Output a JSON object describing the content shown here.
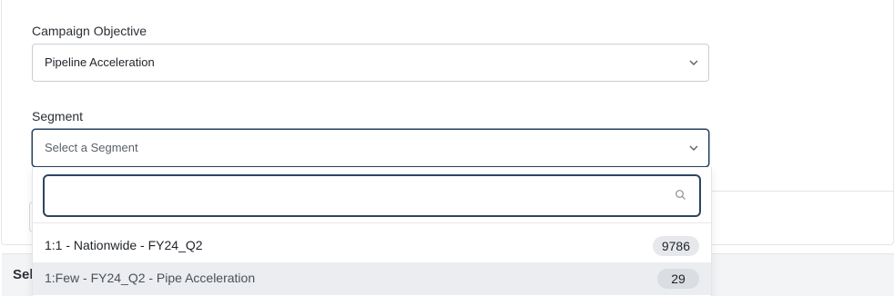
{
  "form": {
    "objective": {
      "label": "Campaign Objective",
      "value": "Pipeline Acceleration"
    },
    "segment": {
      "label": "Segment",
      "placeholder": "Select a Segment"
    }
  },
  "dropdown": {
    "search_value": "",
    "options": [
      {
        "label": "1:1 - Nationwide - FY24_Q2",
        "count": "9786"
      },
      {
        "label": "1:Few - FY24_Q2 - Pipe Acceleration",
        "count": "29"
      }
    ]
  },
  "section": {
    "title": "Select"
  },
  "colors": {
    "focus_border": "#27405f",
    "highlight_row": "#ebedf0",
    "badge_bg": "#e6e8eb"
  },
  "icons": {
    "dropdown": "chevron-down-icon",
    "search": "search-icon"
  }
}
